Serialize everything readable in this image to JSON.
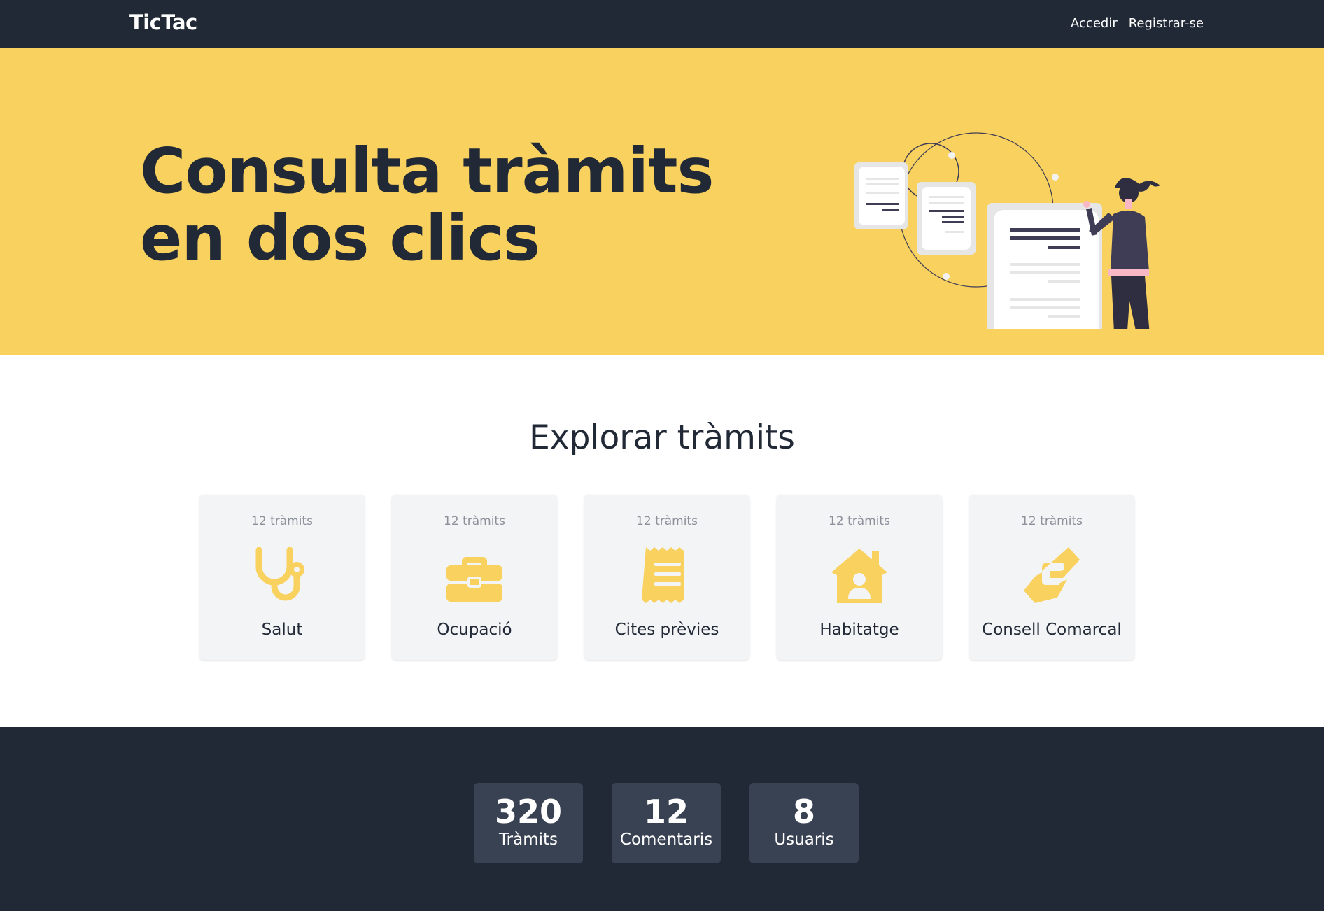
{
  "navbar": {
    "brand": "TicTac",
    "links": [
      "Accedir",
      "Registrar-se"
    ]
  },
  "hero": {
    "title_line1": "Consulta tràmits",
    "title_line2": "en dos clics"
  },
  "explore": {
    "title": "Explorar tràmits",
    "categories": [
      {
        "count": "12 tràmits",
        "label": "Salut",
        "icon": "stethoscope-icon"
      },
      {
        "count": "12 tràmits",
        "label": "Ocupació",
        "icon": "briefcase-icon"
      },
      {
        "count": "12 tràmits",
        "label": "Cites prèvies",
        "icon": "receipt-icon"
      },
      {
        "count": "12 tràmits",
        "label": "Habitatge",
        "icon": "house-user-icon"
      },
      {
        "count": "12 tràmits",
        "label": "Consell Comarcal",
        "icon": "handshake-icon"
      }
    ]
  },
  "stats": [
    {
      "value": "320",
      "label": "Tràmits"
    },
    {
      "value": "12",
      "label": "Comentaris"
    },
    {
      "value": "8",
      "label": "Usuaris"
    }
  ],
  "colors": {
    "dark": "#212936",
    "accent": "#f8d15e",
    "card_bg": "#f3f4f6",
    "stat_bg": "#394252"
  }
}
